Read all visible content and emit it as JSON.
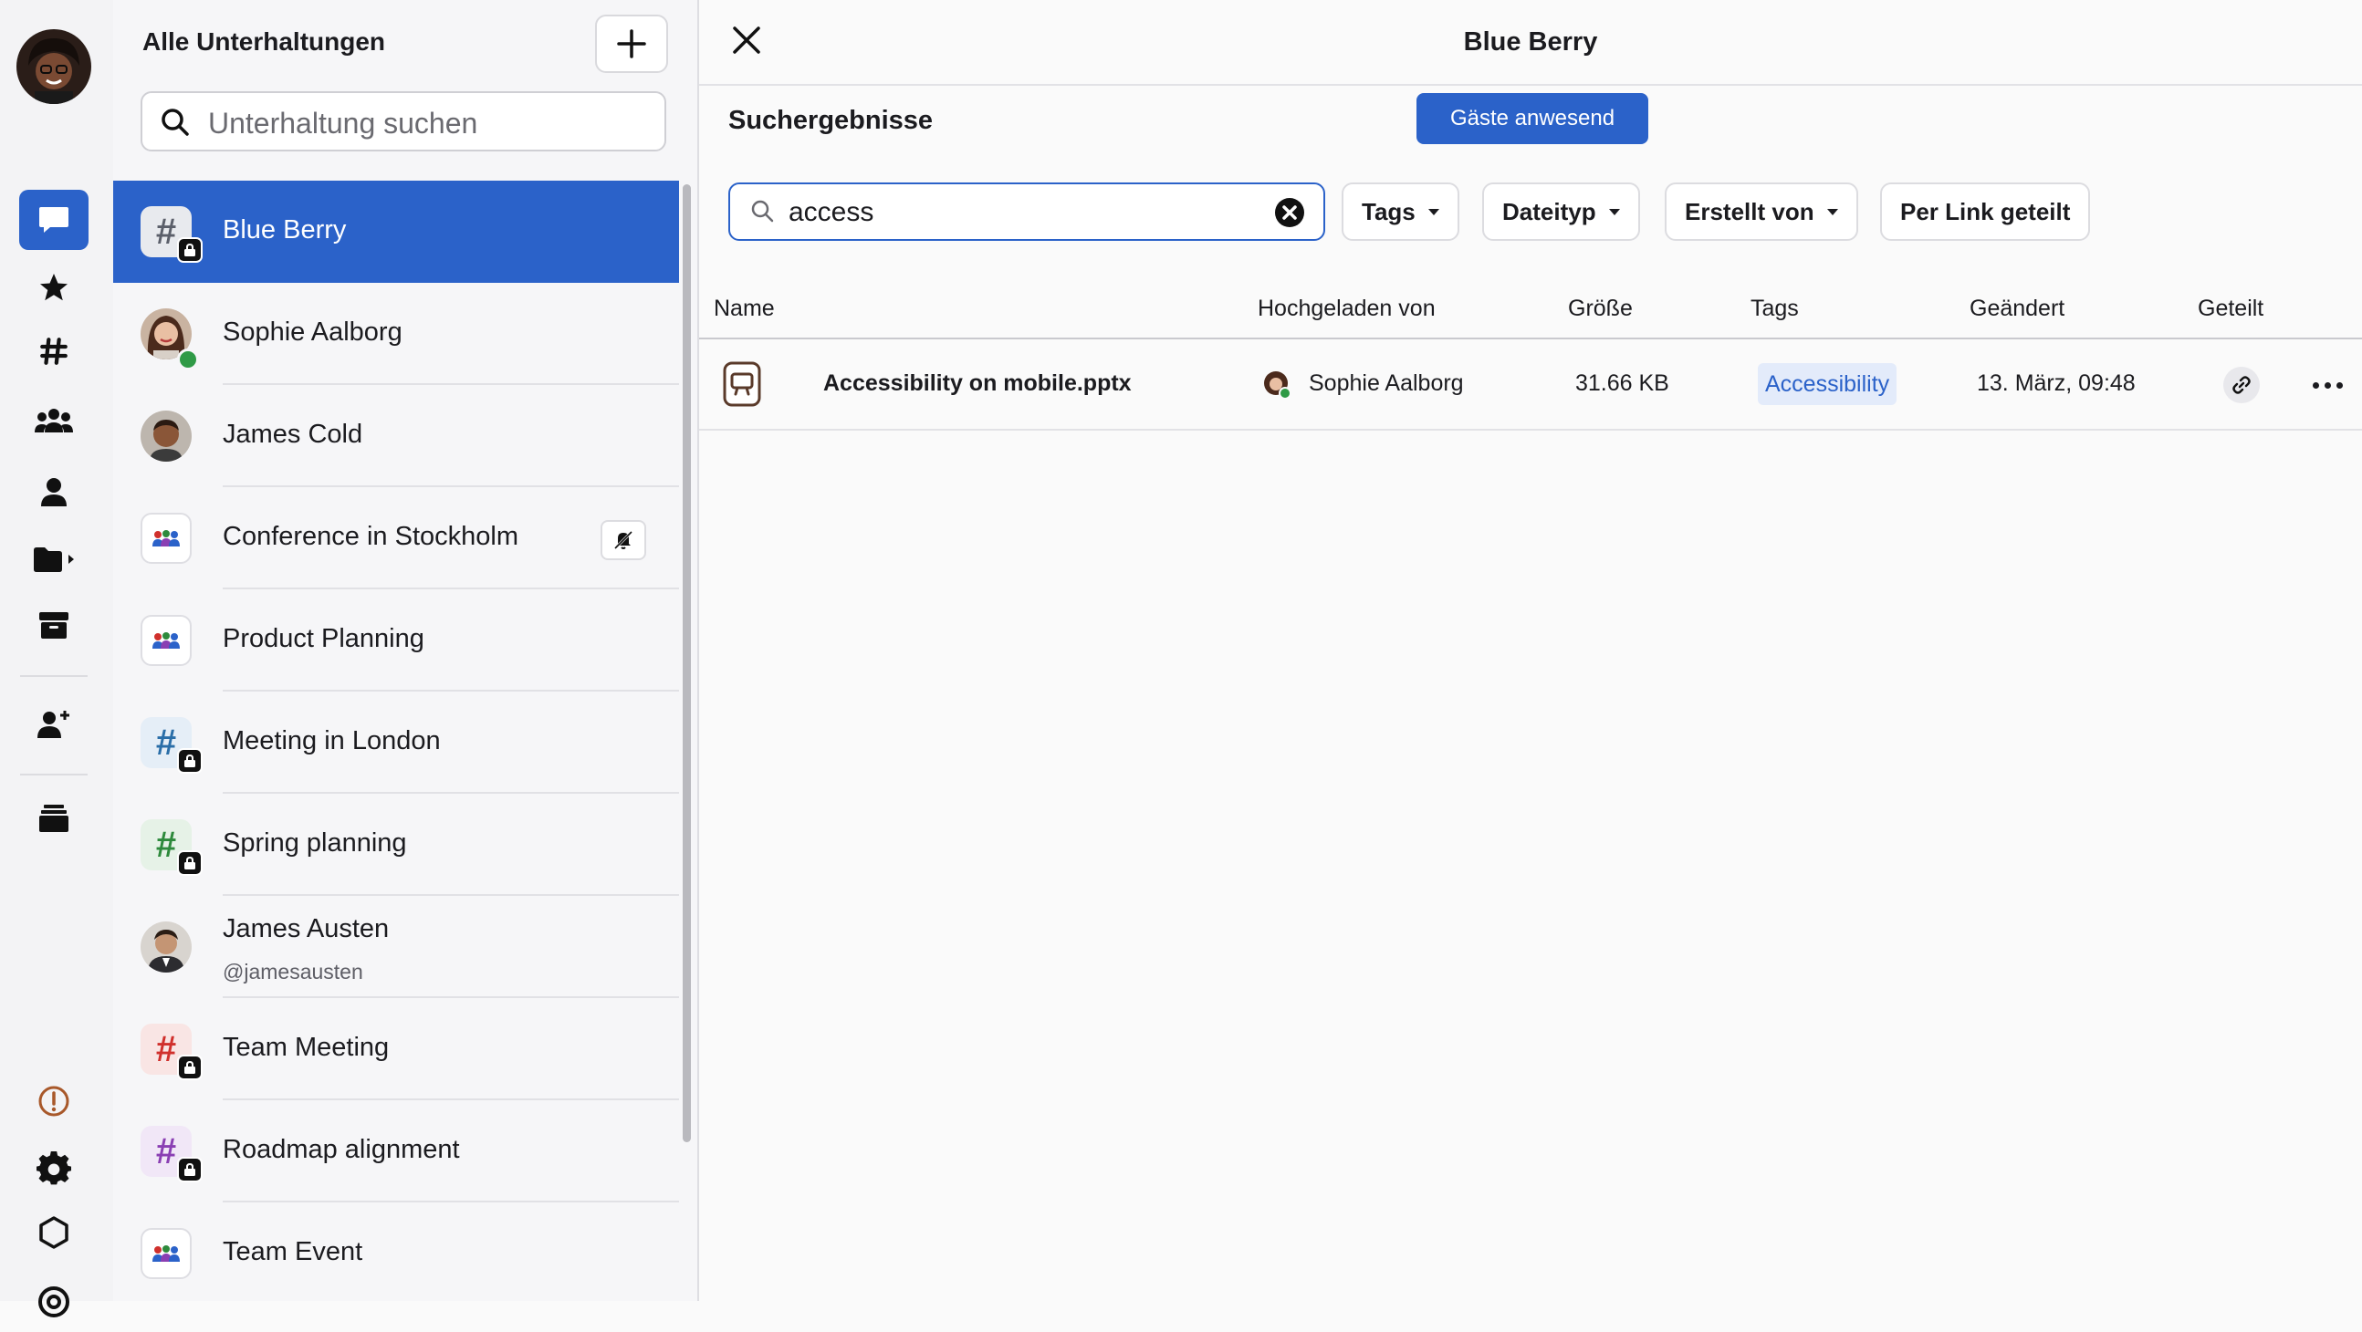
{
  "rail": {
    "items": [
      {
        "name": "chats-icon",
        "active": true
      },
      {
        "name": "star-icon"
      },
      {
        "name": "hash-icon"
      },
      {
        "name": "group-icon"
      },
      {
        "name": "person-icon"
      },
      {
        "name": "folder-icon"
      },
      {
        "name": "archive-icon"
      },
      {
        "name": "add-contact-icon"
      },
      {
        "name": "stack-icon"
      },
      {
        "name": "alert-icon"
      },
      {
        "name": "gear-icon"
      },
      {
        "name": "hexagon-icon"
      }
    ]
  },
  "list": {
    "title": "Alle Unterhaltungen",
    "search_placeholder": "Unterhaltung suchen",
    "conversations": [
      {
        "name": "Blue Berry",
        "type": "channel",
        "hash_color": "#5b5f6a",
        "locked": true,
        "active": true
      },
      {
        "name": "Sophie Aalborg",
        "type": "person",
        "online": true
      },
      {
        "name": "James Cold",
        "type": "person"
      },
      {
        "name": "Conference in Stockholm",
        "type": "group",
        "muted": true
      },
      {
        "name": "Product Planning",
        "type": "group"
      },
      {
        "name": "Meeting in London",
        "type": "channel",
        "hash_color": "#2a6ea8",
        "locked": true
      },
      {
        "name": "Spring planning",
        "type": "channel",
        "hash_color": "#2e8a3c",
        "locked": true
      },
      {
        "name": "James Austen",
        "sub": "@jamesausten",
        "type": "person"
      },
      {
        "name": "Team Meeting",
        "type": "channel",
        "hash_color": "#d0302c",
        "locked": true
      },
      {
        "name": "Roadmap alignment",
        "type": "channel",
        "hash_color": "#8a3fb3",
        "locked": true
      },
      {
        "name": "Team Event",
        "type": "group"
      }
    ]
  },
  "main": {
    "title": "Blue Berry",
    "guests_badge": "Gäste anwesend",
    "results_title": "Suchergebnisse",
    "search_value": "access",
    "filters": {
      "tags": "Tags",
      "filetype": "Dateityp",
      "created_by": "Erstellt von",
      "shared_link": "Per Link geteilt"
    },
    "columns": {
      "name": "Name",
      "uploaded_by": "Hochgeladen von",
      "size": "Größe",
      "tags": "Tags",
      "modified": "Geändert",
      "shared": "Geteilt"
    },
    "files": [
      {
        "name": "Accessibility on mobile.pptx",
        "uploaded_by": "Sophie Aalborg",
        "size": "31.66 KB",
        "tag": "Accessibility",
        "modified": "13. März, 09:48"
      }
    ]
  },
  "colors": {
    "accent": "#2b62c9",
    "online": "#2f9a46"
  }
}
